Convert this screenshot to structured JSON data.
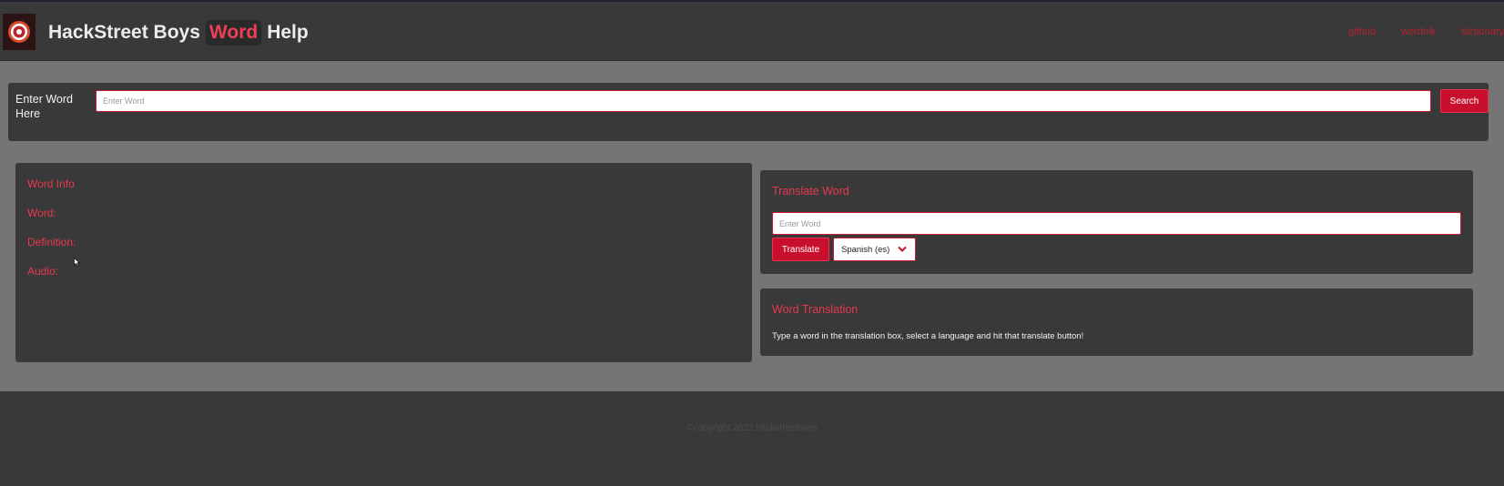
{
  "header": {
    "brand_part1": "HackStreet Boys",
    "brand_highlight": "Word",
    "brand_part2": "Help",
    "logo_icon": "eye-logo-icon",
    "nav_links": [
      "github",
      "wordnik",
      "dictionary"
    ]
  },
  "search": {
    "label": "Enter Word Here",
    "placeholder": "Enter Word",
    "button_label": "Search"
  },
  "word_info": {
    "title": "Word Info",
    "word_label": "Word:",
    "definition_label": "Definition:",
    "audio_label": "Audio:"
  },
  "translate": {
    "title": "Translate Word",
    "placeholder": "Enter Word",
    "button_label": "Translate",
    "language_selected": "Spanish (es)",
    "dropdown_icon": "chevron-down-icon"
  },
  "translation_result": {
    "title": "Word Translation",
    "message": "Type a word in the translation box, select a language and hit that translate button!"
  },
  "footer": {
    "copyright": "©copyright 2022 hackstreetboys"
  },
  "colors": {
    "accent": "#c8102e",
    "accent_text": "#e8384f",
    "panel": "#393939",
    "page_background": "#757575"
  }
}
